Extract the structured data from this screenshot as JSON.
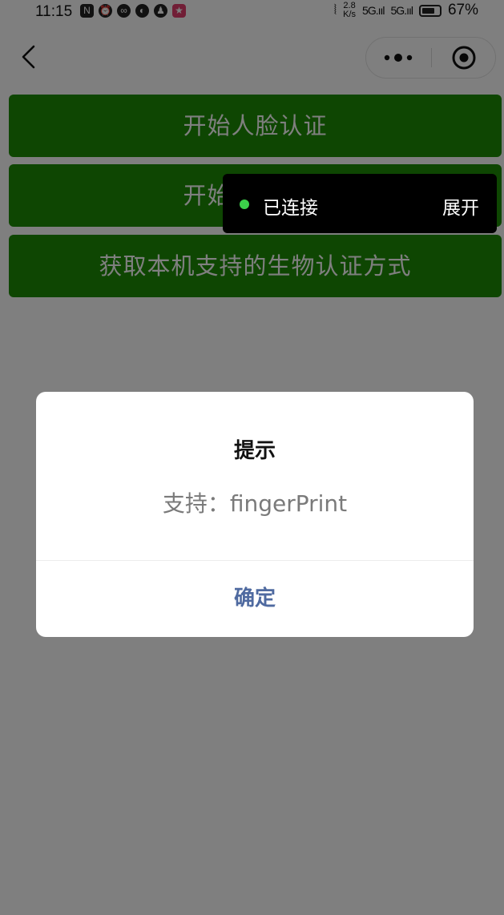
{
  "status_bar": {
    "time": "11:15",
    "net_speed_value": "2.8",
    "net_speed_unit": "K/s",
    "signal1": "5G.ııl",
    "signal2": "5G.ııl",
    "battery_percent": "67%"
  },
  "buttons": [
    {
      "label": "开始人脸认证"
    },
    {
      "label": "开始指纹识别"
    },
    {
      "label": "获取本机支持的生物认证方式"
    }
  ],
  "connection_toast": {
    "status": "已连接",
    "expand": "展开",
    "dot_color": "#3cd24a"
  },
  "modal": {
    "title": "提示",
    "content": "支持：fingerPrint",
    "confirm": "确定",
    "confirm_color": "#4f6aa0"
  },
  "colors": {
    "button_green": "#1c8c05"
  }
}
